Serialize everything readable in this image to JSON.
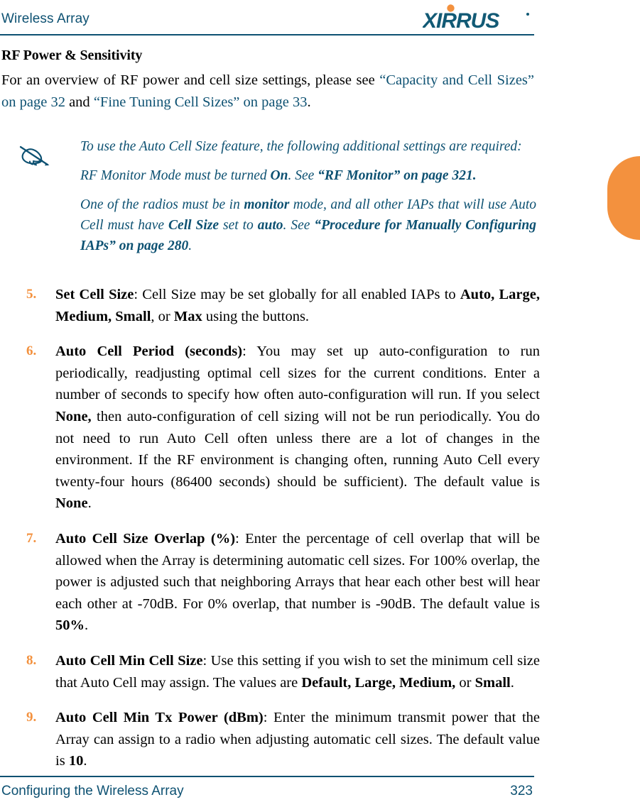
{
  "header": {
    "title": "Wireless Array",
    "logo_text": "XIRRUS",
    "logo_color": "#125a75",
    "logo_dot_color": "#f3913e",
    "rule_color": "#0d5172"
  },
  "accent": {
    "orange": "#f3913e",
    "teal": "#0d5172"
  },
  "edge_tab": {
    "name": "orange-edge-tab",
    "color": "#f3913e"
  },
  "main": {
    "section_title": "RF Power & Sensitivity",
    "intro": {
      "part1": "For an overview of RF power and cell size settings, please see ",
      "xref1": "“Capacity and Cell Sizes” on page 32",
      "part2": " and ",
      "xref2": "“Fine Tuning Cell Sizes” on page 33",
      "part3": "."
    },
    "note": {
      "icon": "note-writing-hand-icon",
      "paragraphs": [
        {
          "text_parts": [
            {
              "t": "To use the Auto Cell Size feature, the following additional settings are required:",
              "b": false
            }
          ]
        },
        {
          "text_parts": [
            {
              "t": "RF Monitor Mode must be turned ",
              "b": false
            },
            {
              "t": "On",
              "b": true
            },
            {
              "t": ". See ",
              "b": false
            },
            {
              "t": "“RF Monitor” on page 321.",
              "b": true
            }
          ]
        },
        {
          "text_parts": [
            {
              "t": "One of the radios must be in ",
              "b": false
            },
            {
              "t": "monitor",
              "b": true
            },
            {
              "t": " mode, and all other IAPs that will use Auto Cell must have ",
              "b": false
            },
            {
              "t": "Cell Size",
              "b": true
            },
            {
              "t": " set to ",
              "b": false
            },
            {
              "t": "auto",
              "b": true
            },
            {
              "t": ". See ",
              "b": false
            },
            {
              "t": "“Procedure for Manually Configuring IAPs” on page 280",
              "b": true
            },
            {
              "t": ".",
              "b": false
            }
          ]
        }
      ]
    },
    "steps": [
      {
        "number": "5.",
        "parts": [
          {
            "t": "Set Cell Size",
            "b": true
          },
          {
            "t": ": Cell Size may be set globally for all enabled IAPs to ",
            "b": false
          },
          {
            "t": "Auto, Large, Medium, Small",
            "b": true
          },
          {
            "t": ", or ",
            "b": false
          },
          {
            "t": "Max",
            "b": true
          },
          {
            "t": " using the buttons.",
            "b": false
          }
        ]
      },
      {
        "number": "6.",
        "parts": [
          {
            "t": "Auto Cell Period (seconds)",
            "b": true
          },
          {
            "t": ": You may set up auto-configuration to run periodically, readjusting optimal cell sizes for the current conditions. Enter a number of seconds to specify how often auto-configuration will run. If you select ",
            "b": false
          },
          {
            "t": "None,",
            "b": true
          },
          {
            "t": " then auto-configuration of cell sizing will not be run periodically. You do not need to run Auto Cell often unless there are a lot of changes in the environment. If the RF environment is changing often, running Auto Cell every twenty-four hours (86400 seconds) should be sufficient). The default value is ",
            "b": false
          },
          {
            "t": "None",
            "b": true
          },
          {
            "t": ".",
            "b": false
          }
        ]
      },
      {
        "number": "7.",
        "parts": [
          {
            "t": "Auto Cell Size Overlap (%)",
            "b": true
          },
          {
            "t": ": Enter the percentage of cell overlap that will be allowed when the Array is determining automatic cell sizes. For 100% overlap, the power is adjusted such that neighboring Arrays that hear each other best will hear each other at -70dB. For 0% overlap, that number is -90dB. The default value is ",
            "b": false
          },
          {
            "t": "50%",
            "b": true
          },
          {
            "t": ".",
            "b": false
          }
        ]
      },
      {
        "number": "8.",
        "parts": [
          {
            "t": "Auto Cell Min Cell Size",
            "b": true
          },
          {
            "t": ": Use this setting if you wish to set the minimum cell size that Auto Cell may assign. The values are ",
            "b": false
          },
          {
            "t": "Default, Large, Medium,",
            "b": true
          },
          {
            "t": " or ",
            "b": false
          },
          {
            "t": "Small",
            "b": true
          },
          {
            "t": ".",
            "b": false
          }
        ]
      },
      {
        "number": "9.",
        "parts": [
          {
            "t": "Auto Cell Min Tx Power (dBm)",
            "b": true
          },
          {
            "t": ": Enter the minimum transmit power that the Array can assign to a radio when adjusting automatic cell sizes. The default value is ",
            "b": false
          },
          {
            "t": "10",
            "b": true
          },
          {
            "t": ".",
            "b": false
          }
        ]
      }
    ]
  },
  "footer": {
    "left": "Configuring the Wireless Array",
    "page_number": "323"
  }
}
